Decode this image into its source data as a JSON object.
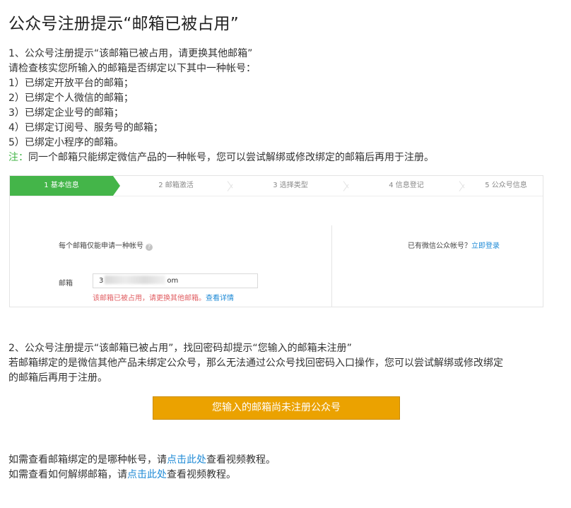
{
  "title": "公众号注册提示“邮箱已被占用”",
  "section1": {
    "heading": "1、公众号注册提示“该邮箱已被占用，请更换其他邮箱”",
    "intro": "请检查核实您所输入的邮箱是否绑定以下其中一种帐号：",
    "items": [
      "1）已绑定开放平台的邮箱；",
      "2）已绑定个人微信的邮箱；",
      "3）已绑定企业号的邮箱；",
      "4）已绑定订阅号、服务号的邮箱；",
      "5）已绑定小程序的邮箱。"
    ],
    "note_label": "注：",
    "note_text": "同一个邮箱只能绑定微信产品的一种帐号，您可以尝试解绑或修改绑定的邮箱后再用于注册。"
  },
  "panel": {
    "steps": [
      "1 基本信息",
      "2 邮箱激活",
      "3 选择类型",
      "4 信息登记",
      "5 公众号信息"
    ],
    "one_email_hint": "每个邮箱仅能申请一种帐号",
    "help_icon": "?",
    "existing_account_text": "已有微信公众帐号？",
    "login_link": "立即登录",
    "email_label": "邮箱",
    "email_prefix": "3",
    "email_suffix": "om",
    "error_text": "该邮箱已被占用，请更换其他邮箱。",
    "error_link": "查看详情"
  },
  "section2": {
    "heading": "2、公众号注册提示“该邮箱已被占用”，找回密码却提示“您输入的邮箱未注册”",
    "line1": "若邮箱绑定的是微信其他产品未绑定公众号，那么无法通过公众号找回密码入口操作，您可以尝试解绑或修改绑定",
    "line2": "的邮箱后再用于注册。",
    "button_label": "您输入的邮箱尚未注册公众号"
  },
  "footer": {
    "line1_prefix": "如需查看邮箱绑定的是哪种帐号，请",
    "line1_link": "点击此处",
    "line1_suffix": "查看视频教程。",
    "line2_prefix": "如需查看如何解绑邮箱，请",
    "line2_link": "点击此处",
    "line2_suffix": "查看视频教程。"
  },
  "colors": {
    "accent_green": "#44b549",
    "link_blue": "#1e8ad6",
    "error_red": "#e15f63",
    "button_orange": "#eba200"
  }
}
